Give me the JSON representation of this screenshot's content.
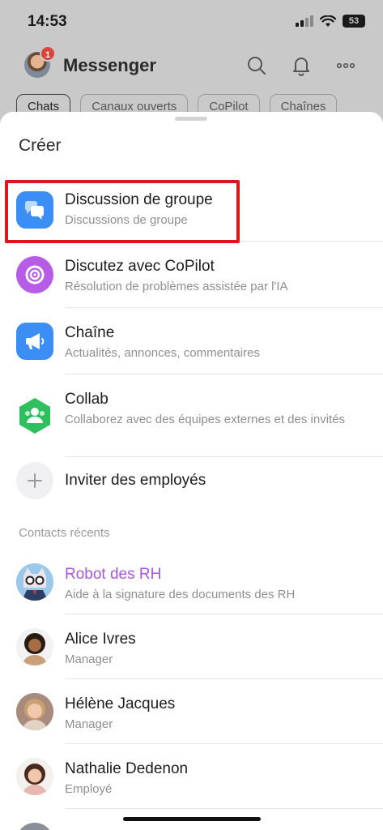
{
  "status_bar": {
    "time": "14:53",
    "battery": "53"
  },
  "app_header": {
    "title": "Messenger",
    "badge_count": "1"
  },
  "tabs": [
    {
      "label": "Chats"
    },
    {
      "label": "Canaux ouverts"
    },
    {
      "label": "CoPilot"
    },
    {
      "label": "Chaînes"
    }
  ],
  "sheet": {
    "title": "Créer",
    "create_items": [
      {
        "title": "Discussion de groupe",
        "subtitle": "Discussions de groupe",
        "icon": "group-chat-icon",
        "color": "#3b8ef5"
      },
      {
        "title": "Discutez avec CoPilot",
        "subtitle": "Résolution de problèmes assistée par l'IA",
        "icon": "copilot-icon",
        "color": "#b65ce6"
      },
      {
        "title": "Chaîne",
        "subtitle": "Actualités, annonces, commentaires",
        "icon": "megaphone-icon",
        "color": "#3b8ef5"
      },
      {
        "title": "Collab",
        "subtitle": "Collaborez avec des équipes externes et des invités",
        "icon": "collab-icon",
        "color": "#2fbf5f"
      },
      {
        "title": "Inviter des employés",
        "subtitle": "",
        "icon": "plus-icon",
        "color": "#f0f0f2"
      }
    ],
    "recent_label": "Contacts récents",
    "contacts": [
      {
        "name": "Robot des RH",
        "role": "Aide à la signature des documents des RH",
        "name_color": "#a855e0"
      },
      {
        "name": "Alice Ivres",
        "role": "Manager",
        "name_color": "#1c1c1e"
      },
      {
        "name": "Hélène Jacques",
        "role": "Manager",
        "name_color": "#1c1c1e"
      },
      {
        "name": "Nathalie Dedenon",
        "role": "Employé",
        "name_color": "#1c1c1e"
      }
    ]
  }
}
